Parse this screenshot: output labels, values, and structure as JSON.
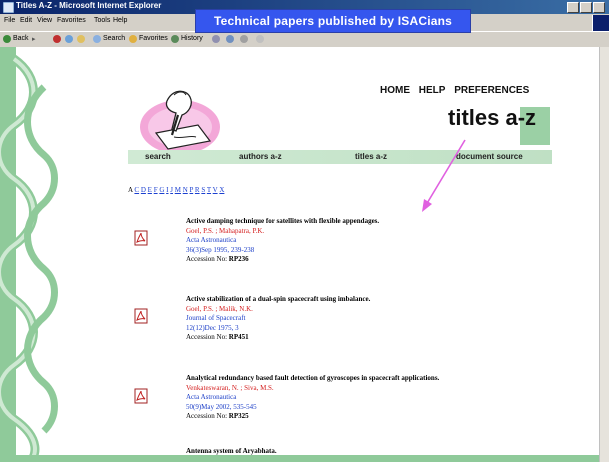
{
  "window": {
    "title": "Titles A-Z - Microsoft Internet Explorer",
    "menu": [
      "File",
      "Edit",
      "View",
      "Favorites",
      "Tools",
      "Help"
    ]
  },
  "toolbar": {
    "back_label": "Back",
    "search_label": "Search",
    "favorites_label": "Favorites",
    "history_label": "History"
  },
  "overlay": {
    "caption": "Technical  papers published by ISACians"
  },
  "site": {
    "top_nav": [
      "HOME",
      "HELP",
      "PREFERENCES"
    ],
    "page_title": "titles a-z",
    "tabs": [
      "search",
      "authors a-z",
      "titles a-z",
      "document source"
    ]
  },
  "alpha_index": {
    "current": "A",
    "links": [
      "C",
      "D",
      "E",
      "F",
      "G",
      "I",
      "J",
      "M",
      "N",
      "P",
      "R",
      "S",
      "T",
      "V",
      "X"
    ]
  },
  "records": [
    {
      "title": "Active damping technique for satellites with flexible appendages.",
      "authors": "Goel, P.S. ; Mahapatra, P.K.",
      "journal": "Acta Astronautica",
      "issue": "36(3)Sep 1995, 239-238",
      "accession_label": "Accession No:",
      "accession_no": "RP236"
    },
    {
      "title": "Active stabilization of a dual-spin spacecraft using imbalance.",
      "authors": "Goel, P.S. ; Malik, N.K.",
      "journal": "Journal of Spacecraft",
      "issue": "12(12)Dec 1975, 3",
      "accession_label": "Accession No:",
      "accession_no": "RP451"
    },
    {
      "title": "Analytical redundancy based fault detection of gyroscopes in spacecraft applications.",
      "authors": "Venkateswaran, N. ; Siva, M.S.",
      "journal": "Acta Astronautica",
      "issue": "50(9)May 2002, 535-545",
      "accession_label": "Accession No:",
      "accession_no": "RP325"
    },
    {
      "title": "Antenna system of Aryabhata.",
      "authors": "",
      "journal": "",
      "issue": "",
      "accession_label": "",
      "accession_no": ""
    }
  ],
  "colors": {
    "overlay_bg": "#3556ee",
    "tab_green": "#bfe0c4",
    "author_red": "#d42020",
    "journal_blue": "#1e40c8",
    "arrow_magenta": "#e060e0"
  }
}
